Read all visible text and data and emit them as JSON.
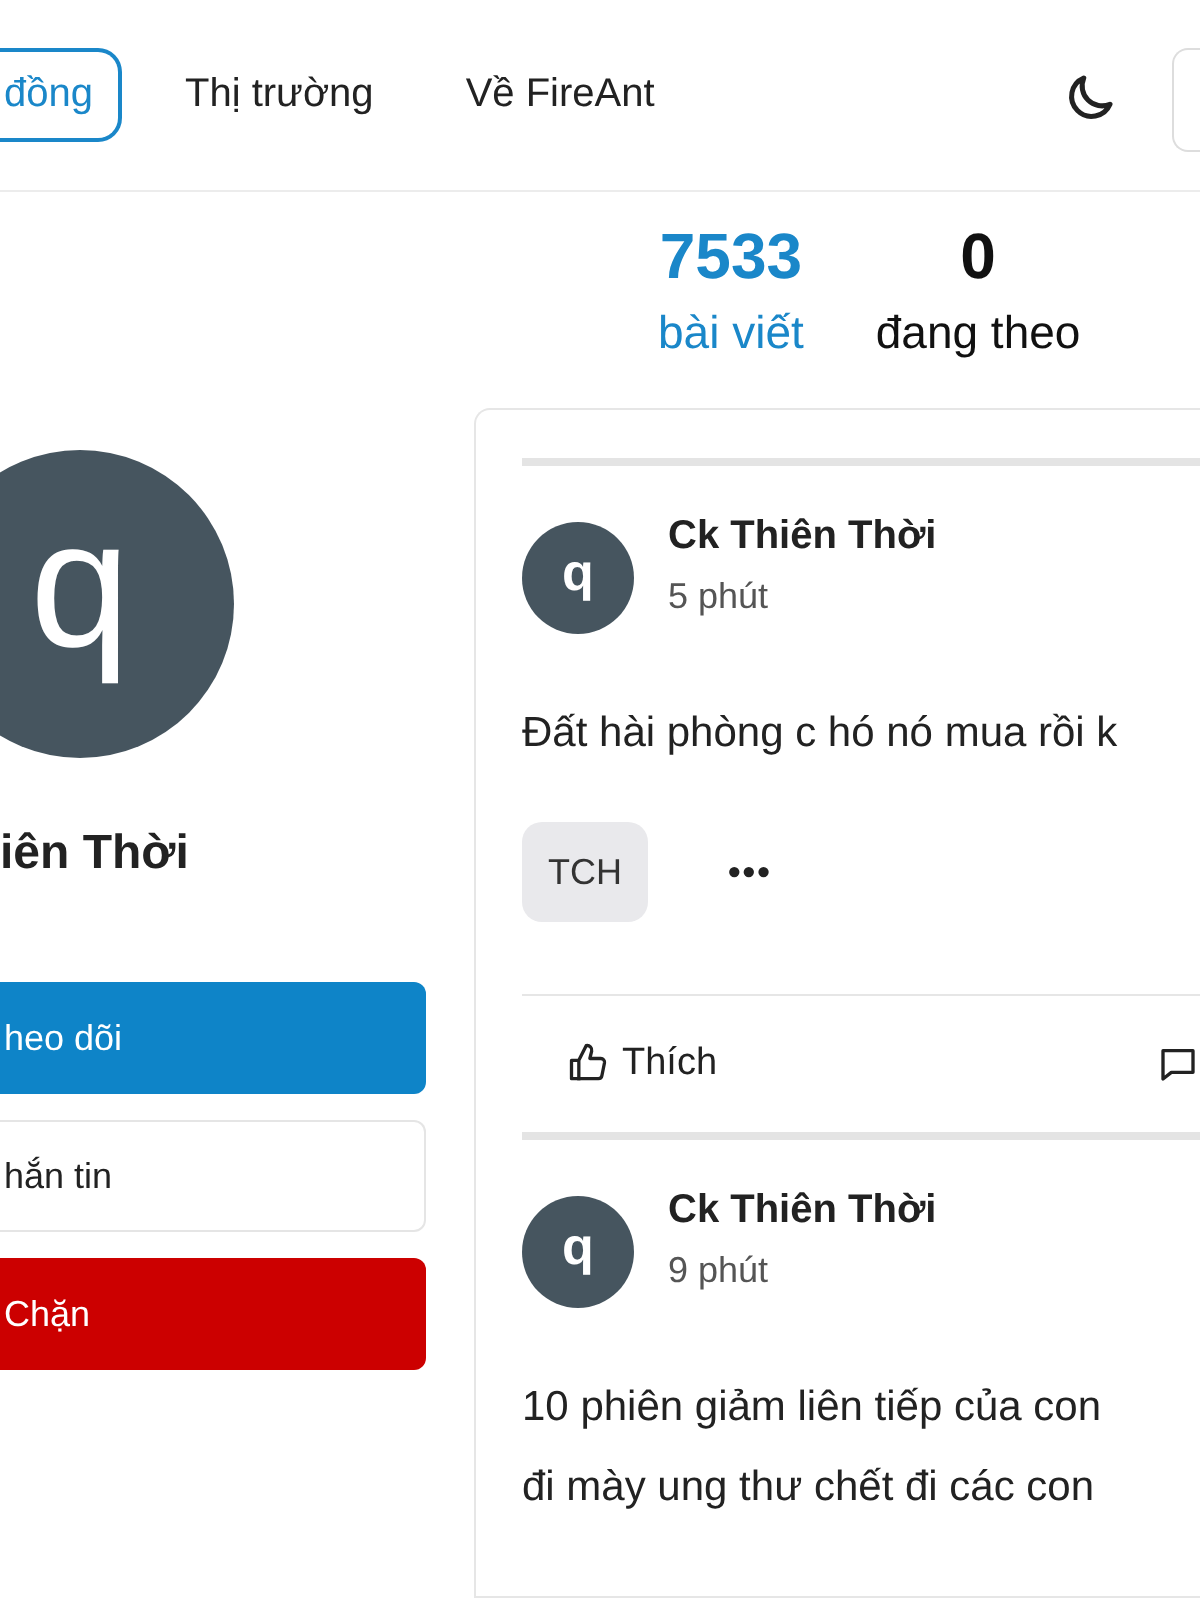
{
  "nav": {
    "items": [
      {
        "label": "đồng",
        "selected": true
      },
      {
        "label": "Thị trường",
        "selected": false
      },
      {
        "label": "Về FireAnt",
        "selected": false
      }
    ]
  },
  "profile": {
    "avatar_letter": "q",
    "name": "iên Thời",
    "buttons": [
      {
        "label": "heo dõi",
        "kind": "primary"
      },
      {
        "label": "hắn tin",
        "kind": "outline"
      },
      {
        "label": "Chặn",
        "kind": "danger"
      }
    ]
  },
  "stats": [
    {
      "value": "7533",
      "label": "bài viết",
      "kind": "accent"
    },
    {
      "value": "0",
      "label": "đang theo",
      "kind": "plain"
    }
  ],
  "posts": [
    {
      "avatar_letter": "q",
      "author": "Ck Thiên Thời",
      "time": "5 phút",
      "lines": [
        "Đất hài phòng c hó nó mua rồi k"
      ],
      "tags": [
        "TCH"
      ],
      "more": "•••",
      "actions": [
        {
          "kind": "like",
          "label": "Thích"
        },
        {
          "kind": "comment"
        }
      ]
    },
    {
      "avatar_letter": "q",
      "author": "Ck Thiên Thời",
      "time": "9 phút",
      "lines": [
        "10 phiên giảm liên tiếp của con",
        "đi mày ung thư chết đi các con"
      ]
    }
  ]
}
